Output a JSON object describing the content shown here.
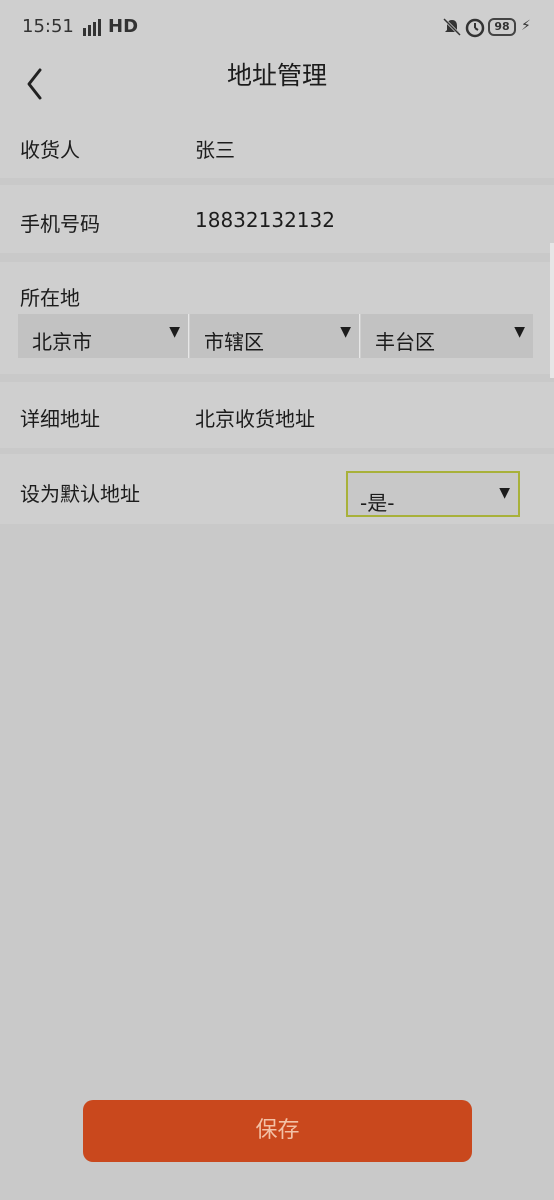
{
  "status_bar": {
    "time": "15:51",
    "network": "HD",
    "battery": "98"
  },
  "header": {
    "title": "地址管理"
  },
  "form": {
    "receiver": {
      "label": "收货人",
      "value": "张三"
    },
    "phone": {
      "label": "手机号码",
      "value": "18832132132"
    },
    "location": {
      "label": "所在地",
      "province": "北京市",
      "city": "市辖区",
      "district": "丰台区"
    },
    "detail": {
      "label": "详细地址",
      "value": "北京收货地址"
    },
    "default": {
      "label": "设为默认地址",
      "value": "-是-"
    }
  },
  "actions": {
    "save": "保存"
  },
  "colors": {
    "accent": "#c9481d",
    "background": "#c9c9c9"
  }
}
